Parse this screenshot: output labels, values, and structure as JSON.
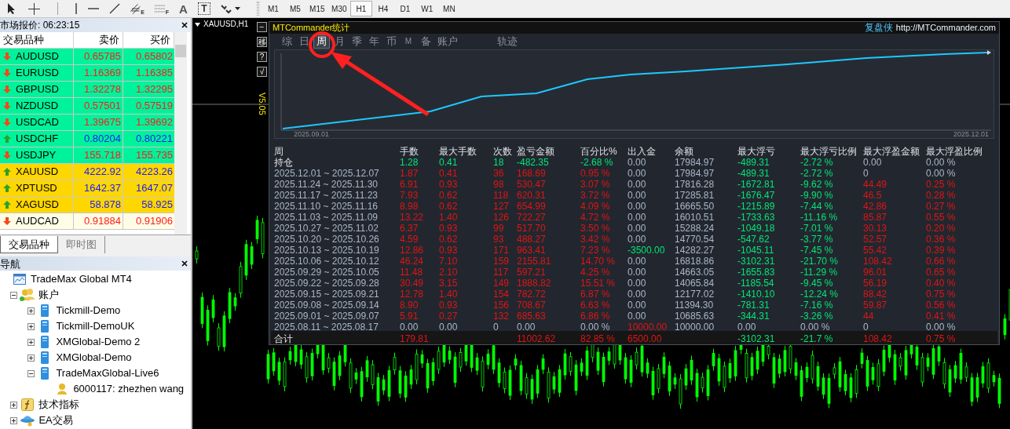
{
  "toolbar": {
    "tools": [
      {
        "kind": "cursor"
      },
      {
        "kind": "crosshair"
      },
      {
        "kind": "separator"
      },
      {
        "kind": "vline"
      },
      {
        "kind": "hline"
      },
      {
        "kind": "trend"
      },
      {
        "kind": "channel",
        "label": "E"
      },
      {
        "kind": "fibo",
        "label": "F"
      },
      {
        "kind": "text",
        "label": "A"
      },
      {
        "kind": "textbox",
        "label": "T"
      },
      {
        "kind": "arrows"
      },
      {
        "kind": "grip"
      }
    ],
    "timeframes": [
      {
        "label": "M1",
        "selected": false
      },
      {
        "label": "M5",
        "selected": false
      },
      {
        "label": "M15",
        "selected": false
      },
      {
        "label": "M30",
        "selected": false
      },
      {
        "label": "H1",
        "selected": true
      },
      {
        "label": "H4",
        "selected": false
      },
      {
        "label": "D1",
        "selected": false
      },
      {
        "label": "W1",
        "selected": false
      },
      {
        "label": "MN",
        "selected": false
      }
    ]
  },
  "market_watch": {
    "title": "市场报价: 06:23:15",
    "columns": [
      "交易品种",
      "卖价",
      "买价"
    ],
    "rows": [
      {
        "symbol": "AUDUSD",
        "bid": "0.65785",
        "ask": "0.65802",
        "kind": "down",
        "color": "#00f29a"
      },
      {
        "symbol": "EURUSD",
        "bid": "1.16369",
        "ask": "1.16385",
        "kind": "down",
        "color": "#00f29a"
      },
      {
        "symbol": "GBPUSD",
        "bid": "1.32278",
        "ask": "1.32295",
        "kind": "down",
        "color": "#00f29a"
      },
      {
        "symbol": "NZDUSD",
        "bid": "0.57501",
        "ask": "0.57519",
        "kind": "down",
        "color": "#00f29a"
      },
      {
        "symbol": "USDCAD",
        "bid": "1.39675",
        "ask": "1.39692",
        "kind": "down",
        "color": "#00f29a"
      },
      {
        "symbol": "USDCHF",
        "bid": "0.80204",
        "ask": "0.80221",
        "kind": "up",
        "color": "#00f29a"
      },
      {
        "symbol": "USDJPY",
        "bid": "155.718",
        "ask": "155.735",
        "kind": "down",
        "color": "#00f29a"
      },
      {
        "symbol": "XAUUSD",
        "bid": "4222.92",
        "ask": "4223.26",
        "kind": "up",
        "color": "#ffd700"
      },
      {
        "symbol": "XPTUSD",
        "bid": "1642.37",
        "ask": "1647.07",
        "kind": "up",
        "color": "#ffd700"
      },
      {
        "symbol": "XAGUSD",
        "bid": "58.878",
        "ask": "58.925",
        "kind": "up",
        "color": "#ffd700"
      },
      {
        "symbol": "AUDCAD",
        "bid": "0.91884",
        "ask": "0.91906",
        "kind": "down",
        "color": "#fffde6"
      }
    ],
    "tabs": [
      {
        "label": "交易品种",
        "selected": true
      },
      {
        "label": "即时图",
        "selected": false
      }
    ]
  },
  "navigator": {
    "title": "导航",
    "tree": [
      {
        "label": "TradeMax Global MT4",
        "kind": "root",
        "children": [
          {
            "label": "账户",
            "kind": "accounts",
            "expanded": true,
            "children": [
              {
                "label": "Tickmill-Demo",
                "kind": "server",
                "expanded": false
              },
              {
                "label": "Tickmill-DemoUK",
                "kind": "server",
                "expanded": false
              },
              {
                "label": "XMGlobal-Demo 2",
                "kind": "server",
                "expanded": false
              },
              {
                "label": "XMGlobal-Demo",
                "kind": "server",
                "expanded": false
              },
              {
                "label": "TradeMaxGlobal-Live6",
                "kind": "server",
                "expanded": true,
                "children": [
                  {
                    "label": "6000117: zhezhen wang",
                    "kind": "account"
                  }
                ]
              }
            ]
          },
          {
            "label": "技术指标",
            "kind": "indicators",
            "expanded": false
          },
          {
            "label": "EA交易",
            "kind": "experts",
            "expanded": false
          }
        ]
      }
    ]
  },
  "chart": {
    "title": "XAUUSD,H1",
    "side_buttons": [
      "−",
      "移",
      "?",
      "√"
    ],
    "version": "V5.05"
  },
  "stats": {
    "title": "MTCommander统计",
    "brand": "复盘侠",
    "url": "http://MTCommander.com",
    "tabs": [
      {
        "label": "综",
        "selected": false
      },
      {
        "label": "日",
        "selected": false
      },
      {
        "label": "周",
        "selected": true
      },
      {
        "label": "月",
        "selected": false
      },
      {
        "label": "季",
        "selected": false
      },
      {
        "label": "年",
        "selected": false
      },
      {
        "label": "币",
        "selected": false
      },
      {
        "label": "M",
        "selected": false
      },
      {
        "label": "备",
        "selected": false
      },
      {
        "label": "账户",
        "selected": false
      },
      {
        "label": "轨迹",
        "selected": false
      }
    ],
    "equity_dates": [
      "2025.09.01",
      "2025.12.01"
    ],
    "columns": [
      "周",
      "手数",
      "最大手数",
      "次数",
      "盈亏金额",
      "百分比%",
      "出入金",
      "余额",
      "最大浮亏",
      "最大浮亏比例",
      "最大浮盈金额",
      "最大浮盈比例"
    ],
    "rows": [
      {
        "cells": [
          {
            "text": "持仓"
          },
          {
            "text": "1.28",
            "color": "#00e676"
          },
          {
            "text": "0.41",
            "color": "#00e676"
          },
          {
            "text": "18",
            "color": "#00e676"
          },
          {
            "text": "-482.35",
            "color": "#00e676"
          },
          {
            "text": "-2.68 %",
            "color": "#00e676"
          },
          {
            "text": "0.00",
            "color": "#aab6c8"
          },
          {
            "text": "17984.97",
            "color": "#aab6c8"
          },
          {
            "text": "-489.31",
            "color": "#00e676"
          },
          {
            "text": "-2.72 %",
            "color": "#00e676"
          },
          {
            "text": "0.00",
            "color": "#aab6c8"
          },
          {
            "text": "0.00 %",
            "color": "#aab6c8"
          }
        ]
      },
      {
        "cells": [
          {
            "text": "2025.12.01 ~ 2025.12.07",
            "color": "#aab6c8"
          },
          {
            "text": "1.87",
            "color": "#e01414"
          },
          {
            "text": "0.41",
            "color": "#e01414"
          },
          {
            "text": "36",
            "color": "#e01414"
          },
          {
            "text": "168.69",
            "color": "#e01414"
          },
          {
            "text": "0.95 %",
            "color": "#e01414"
          },
          {
            "text": "0.00",
            "color": "#aab6c8"
          },
          {
            "text": "17984.97",
            "color": "#aab6c8"
          },
          {
            "text": "-489.31",
            "color": "#00e676"
          },
          {
            "text": "-2.72 %",
            "color": "#00e676"
          },
          {
            "text": "0",
            "color": "#aab6c8"
          },
          {
            "text": "0.00 %",
            "color": "#aab6c8"
          }
        ]
      },
      {
        "cells": [
          {
            "text": "2025.11.24 ~ 2025.11.30",
            "color": "#aab6c8"
          },
          {
            "text": "6.91",
            "color": "#e01414"
          },
          {
            "text": "0.93",
            "color": "#e01414"
          },
          {
            "text": "98",
            "color": "#e01414"
          },
          {
            "text": "530.47",
            "color": "#e01414"
          },
          {
            "text": "3.07 %",
            "color": "#e01414"
          },
          {
            "text": "0.00",
            "color": "#aab6c8"
          },
          {
            "text": "17816.28",
            "color": "#aab6c8"
          },
          {
            "text": "-1672.81",
            "color": "#00e676"
          },
          {
            "text": "-9.62 %",
            "color": "#00e676"
          },
          {
            "text": "44.49",
            "color": "#e01414"
          },
          {
            "text": "0.25 %",
            "color": "#e01414"
          }
        ]
      },
      {
        "cells": [
          {
            "text": "2025.11.17 ~ 2025.11.23",
            "color": "#aab6c8"
          },
          {
            "text": "7.93",
            "color": "#e01414"
          },
          {
            "text": "0.62",
            "color": "#e01414"
          },
          {
            "text": "118",
            "color": "#e01414"
          },
          {
            "text": "620.31",
            "color": "#e01414"
          },
          {
            "text": "3.72 %",
            "color": "#e01414"
          },
          {
            "text": "0.00",
            "color": "#aab6c8"
          },
          {
            "text": "17285.81",
            "color": "#aab6c8"
          },
          {
            "text": "-1676.47",
            "color": "#00e676"
          },
          {
            "text": "-9.90 %",
            "color": "#00e676"
          },
          {
            "text": "46.5",
            "color": "#e01414"
          },
          {
            "text": "0.28 %",
            "color": "#e01414"
          }
        ]
      },
      {
        "cells": [
          {
            "text": "2025.11.10 ~ 2025.11.16",
            "color": "#aab6c8"
          },
          {
            "text": "8.98",
            "color": "#e01414"
          },
          {
            "text": "0.62",
            "color": "#e01414"
          },
          {
            "text": "127",
            "color": "#e01414"
          },
          {
            "text": "654.99",
            "color": "#e01414"
          },
          {
            "text": "4.09 %",
            "color": "#e01414"
          },
          {
            "text": "0.00",
            "color": "#aab6c8"
          },
          {
            "text": "16665.50",
            "color": "#aab6c8"
          },
          {
            "text": "-1215.89",
            "color": "#00e676"
          },
          {
            "text": "-7.44 %",
            "color": "#00e676"
          },
          {
            "text": "42.86",
            "color": "#e01414"
          },
          {
            "text": "0.27 %",
            "color": "#e01414"
          }
        ]
      },
      {
        "cells": [
          {
            "text": "2025.11.03 ~ 2025.11.09",
            "color": "#aab6c8"
          },
          {
            "text": "13.22",
            "color": "#e01414"
          },
          {
            "text": "1.40",
            "color": "#e01414"
          },
          {
            "text": "126",
            "color": "#e01414"
          },
          {
            "text": "722.27",
            "color": "#e01414"
          },
          {
            "text": "4.72 %",
            "color": "#e01414"
          },
          {
            "text": "0.00",
            "color": "#aab6c8"
          },
          {
            "text": "16010.51",
            "color": "#aab6c8"
          },
          {
            "text": "-1733.63",
            "color": "#00e676"
          },
          {
            "text": "-11.16 %",
            "color": "#00e676"
          },
          {
            "text": "85.87",
            "color": "#e01414"
          },
          {
            "text": "0.55 %",
            "color": "#e01414"
          }
        ]
      },
      {
        "cells": [
          {
            "text": "2025.10.27 ~ 2025.11.02",
            "color": "#aab6c8"
          },
          {
            "text": "6.37",
            "color": "#e01414"
          },
          {
            "text": "0.93",
            "color": "#e01414"
          },
          {
            "text": "99",
            "color": "#e01414"
          },
          {
            "text": "517.70",
            "color": "#e01414"
          },
          {
            "text": "3.50 %",
            "color": "#e01414"
          },
          {
            "text": "0.00",
            "color": "#aab6c8"
          },
          {
            "text": "15288.24",
            "color": "#aab6c8"
          },
          {
            "text": "-1049.18",
            "color": "#00e676"
          },
          {
            "text": "-7.01 %",
            "color": "#00e676"
          },
          {
            "text": "30.13",
            "color": "#e01414"
          },
          {
            "text": "0.20 %",
            "color": "#e01414"
          }
        ]
      },
      {
        "cells": [
          {
            "text": "2025.10.20 ~ 2025.10.26",
            "color": "#aab6c8"
          },
          {
            "text": "4.59",
            "color": "#e01414"
          },
          {
            "text": "0.62",
            "color": "#e01414"
          },
          {
            "text": "93",
            "color": "#e01414"
          },
          {
            "text": "488.27",
            "color": "#e01414"
          },
          {
            "text": "3.42 %",
            "color": "#e01414"
          },
          {
            "text": "0.00",
            "color": "#aab6c8"
          },
          {
            "text": "14770.54",
            "color": "#aab6c8"
          },
          {
            "text": "-547.62",
            "color": "#00e676"
          },
          {
            "text": "-3.77 %",
            "color": "#00e676"
          },
          {
            "text": "52.57",
            "color": "#e01414"
          },
          {
            "text": "0.36 %",
            "color": "#e01414"
          }
        ]
      },
      {
        "cells": [
          {
            "text": "2025.10.13 ~ 2025.10.19",
            "color": "#aab6c8"
          },
          {
            "text": "12.86",
            "color": "#e01414"
          },
          {
            "text": "0.93",
            "color": "#e01414"
          },
          {
            "text": "171",
            "color": "#e01414"
          },
          {
            "text": "963.41",
            "color": "#e01414"
          },
          {
            "text": "7.23 %",
            "color": "#e01414"
          },
          {
            "text": "-3500.00",
            "color": "#00e676"
          },
          {
            "text": "14282.27",
            "color": "#aab6c8"
          },
          {
            "text": "-1045.11",
            "color": "#00e676"
          },
          {
            "text": "-7.45 %",
            "color": "#00e676"
          },
          {
            "text": "55.42",
            "color": "#e01414"
          },
          {
            "text": "0.39 %",
            "color": "#e01414"
          }
        ]
      },
      {
        "cells": [
          {
            "text": "2025.10.06 ~ 2025.10.12",
            "color": "#aab6c8"
          },
          {
            "text": "46.24",
            "color": "#e01414"
          },
          {
            "text": "7.10",
            "color": "#e01414"
          },
          {
            "text": "159",
            "color": "#e01414"
          },
          {
            "text": "2155.81",
            "color": "#e01414"
          },
          {
            "text": "14.70 %",
            "color": "#e01414"
          },
          {
            "text": "0.00",
            "color": "#aab6c8"
          },
          {
            "text": "16818.86",
            "color": "#aab6c8"
          },
          {
            "text": "-3102.31",
            "color": "#00e676"
          },
          {
            "text": "-21.70 %",
            "color": "#00e676"
          },
          {
            "text": "108.42",
            "color": "#e01414"
          },
          {
            "text": "0.66 %",
            "color": "#e01414"
          }
        ]
      },
      {
        "cells": [
          {
            "text": "2025.09.29 ~ 2025.10.05",
            "color": "#aab6c8"
          },
          {
            "text": "11.48",
            "color": "#e01414"
          },
          {
            "text": "2.10",
            "color": "#e01414"
          },
          {
            "text": "117",
            "color": "#e01414"
          },
          {
            "text": "597.21",
            "color": "#e01414"
          },
          {
            "text": "4.25 %",
            "color": "#e01414"
          },
          {
            "text": "0.00",
            "color": "#aab6c8"
          },
          {
            "text": "14663.05",
            "color": "#aab6c8"
          },
          {
            "text": "-1655.83",
            "color": "#00e676"
          },
          {
            "text": "-11.29 %",
            "color": "#00e676"
          },
          {
            "text": "96.01",
            "color": "#e01414"
          },
          {
            "text": "0.65 %",
            "color": "#e01414"
          }
        ]
      },
      {
        "cells": [
          {
            "text": "2025.09.22 ~ 2025.09.28",
            "color": "#aab6c8"
          },
          {
            "text": "30.49",
            "color": "#e01414"
          },
          {
            "text": "3.15",
            "color": "#e01414"
          },
          {
            "text": "149",
            "color": "#e01414"
          },
          {
            "text": "1888.82",
            "color": "#e01414"
          },
          {
            "text": "15.51 %",
            "color": "#e01414"
          },
          {
            "text": "0.00",
            "color": "#aab6c8"
          },
          {
            "text": "14065.84",
            "color": "#aab6c8"
          },
          {
            "text": "-1185.54",
            "color": "#00e676"
          },
          {
            "text": "-9.45 %",
            "color": "#00e676"
          },
          {
            "text": "56.19",
            "color": "#e01414"
          },
          {
            "text": "0.40 %",
            "color": "#e01414"
          }
        ]
      },
      {
        "cells": [
          {
            "text": "2025.09.15 ~ 2025.09.21",
            "color": "#aab6c8"
          },
          {
            "text": "12.78",
            "color": "#e01414"
          },
          {
            "text": "1.40",
            "color": "#e01414"
          },
          {
            "text": "154",
            "color": "#e01414"
          },
          {
            "text": "782.72",
            "color": "#e01414"
          },
          {
            "text": "6.87 %",
            "color": "#e01414"
          },
          {
            "text": "0.00",
            "color": "#aab6c8"
          },
          {
            "text": "12177.02",
            "color": "#aab6c8"
          },
          {
            "text": "-1410.10",
            "color": "#00e676"
          },
          {
            "text": "-12.24 %",
            "color": "#00e676"
          },
          {
            "text": "88.42",
            "color": "#e01414"
          },
          {
            "text": "0.75 %",
            "color": "#e01414"
          }
        ]
      },
      {
        "cells": [
          {
            "text": "2025.09.08 ~ 2025.09.14",
            "color": "#aab6c8"
          },
          {
            "text": "8.90",
            "color": "#e01414"
          },
          {
            "text": "0.93",
            "color": "#e01414"
          },
          {
            "text": "156",
            "color": "#e01414"
          },
          {
            "text": "708.67",
            "color": "#e01414"
          },
          {
            "text": "6.63 %",
            "color": "#e01414"
          },
          {
            "text": "0.00",
            "color": "#aab6c8"
          },
          {
            "text": "11394.30",
            "color": "#aab6c8"
          },
          {
            "text": "-781.31",
            "color": "#00e676"
          },
          {
            "text": "-7.16 %",
            "color": "#00e676"
          },
          {
            "text": "59.87",
            "color": "#e01414"
          },
          {
            "text": "0.56 %",
            "color": "#e01414"
          }
        ]
      },
      {
        "cells": [
          {
            "text": "2025.09.01 ~ 2025.09.07",
            "color": "#aab6c8"
          },
          {
            "text": "5.91",
            "color": "#e01414"
          },
          {
            "text": "0.27",
            "color": "#e01414"
          },
          {
            "text": "132",
            "color": "#e01414"
          },
          {
            "text": "685.63",
            "color": "#e01414"
          },
          {
            "text": "6.86 %",
            "color": "#e01414"
          },
          {
            "text": "0.00",
            "color": "#aab6c8"
          },
          {
            "text": "10685.63",
            "color": "#aab6c8"
          },
          {
            "text": "-344.31",
            "color": "#00e676"
          },
          {
            "text": "-3.26 %",
            "color": "#00e676"
          },
          {
            "text": "44",
            "color": "#e01414"
          },
          {
            "text": "0.41 %",
            "color": "#e01414"
          }
        ]
      },
      {
        "cells": [
          {
            "text": "2025.08.11 ~ 2025.08.17",
            "color": "#aab6c8"
          },
          {
            "text": "0.00",
            "color": "#aab6c8"
          },
          {
            "text": "0.00",
            "color": "#aab6c8"
          },
          {
            "text": "0",
            "color": "#aab6c8"
          },
          {
            "text": "0.00",
            "color": "#aab6c8"
          },
          {
            "text": "0.00 %",
            "color": "#aab6c8"
          },
          {
            "text": "10000.00",
            "color": "#e01414"
          },
          {
            "text": "10000.00",
            "color": "#aab6c8"
          },
          {
            "text": "0.00",
            "color": "#aab6c8"
          },
          {
            "text": "0.00 %",
            "color": "#aab6c8"
          },
          {
            "text": "0",
            "color": "#aab6c8"
          },
          {
            "text": "0.00 %",
            "color": "#aab6c8"
          }
        ]
      }
    ],
    "total": {
      "cells": [
        {
          "text": "合计"
        },
        {
          "text": "179.81",
          "color": "#e01414"
        },
        null,
        null,
        {
          "text": "11002.62",
          "color": "#e01414"
        },
        {
          "text": "82.85 %",
          "color": "#e01414"
        },
        {
          "text": "6500.00",
          "color": "#e01414"
        },
        null,
        {
          "text": "-3102.31",
          "color": "#00e676"
        },
        {
          "text": "-21.7 %",
          "color": "#00e676"
        },
        {
          "text": "108.42",
          "color": "#e01414"
        },
        {
          "text": "0.75 %",
          "color": "#e01414"
        }
      ]
    }
  }
}
